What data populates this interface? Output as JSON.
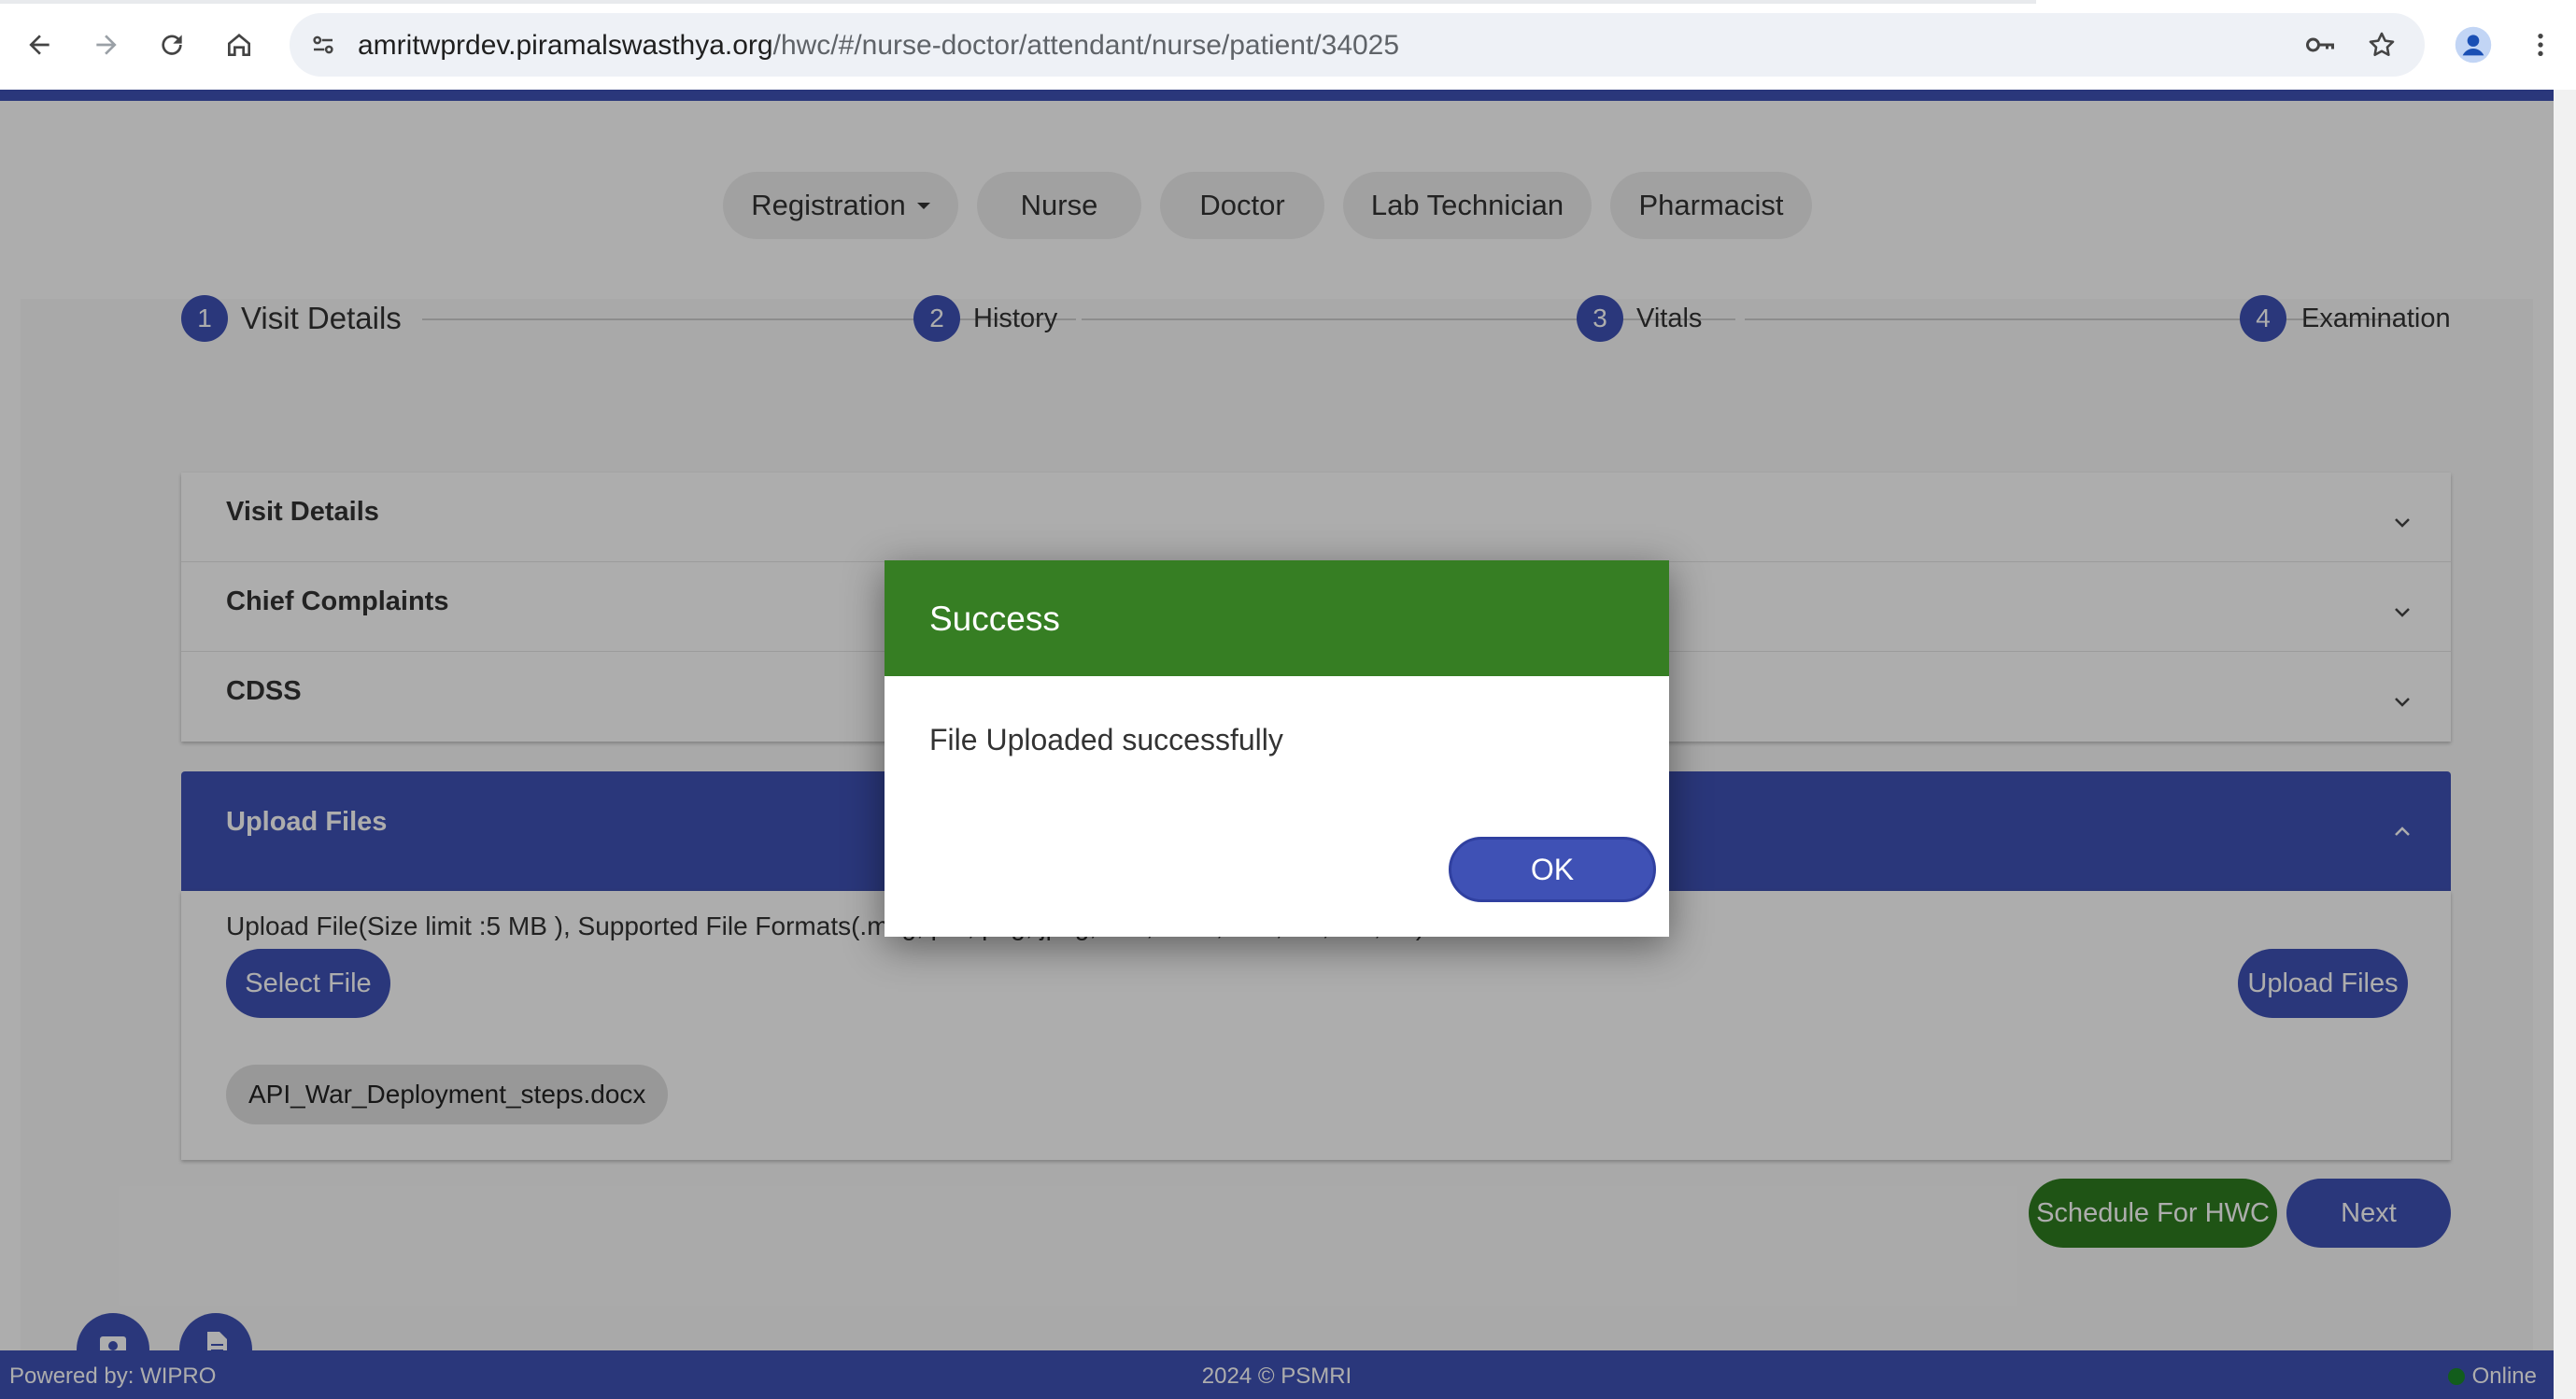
{
  "browser": {
    "url_host": "amritwprdev.piramalswasthya.org",
    "url_path": "/hwc/#/nurse-doctor/attendant/nurse/patient/34025"
  },
  "roles": [
    "Registration",
    "Nurse",
    "Doctor",
    "Lab Technician",
    "Pharmacist"
  ],
  "stepper": [
    {
      "number": "1",
      "label": "Visit Details"
    },
    {
      "number": "2",
      "label": "History"
    },
    {
      "number": "3",
      "label": "Vitals"
    },
    {
      "number": "4",
      "label": "Examination"
    }
  ],
  "accordion": [
    "Visit Details",
    "Chief Complaints",
    "CDSS"
  ],
  "upload": {
    "title": "Upload Files",
    "info": "Upload File(Size limit :5 MB ), Supported File Formats(.msg,.pdf,.png,.jpeg,.doc,.docx,.xlsx,.xls,.csv,.txt)",
    "select_label": "Select File",
    "upload_label": "Upload Files",
    "file_name": "API_War_Deployment_steps.docx"
  },
  "actions": {
    "schedule_label": "Schedule For HWC",
    "next_label": "Next"
  },
  "footer": {
    "powered": "Powered by: WIPRO",
    "copyright": "2024 © PSMRI",
    "status": "Online"
  },
  "dialog": {
    "title": "Success",
    "message": "File Uploaded successfully",
    "ok_label": "OK"
  },
  "colors": {
    "primary": "#3f51b5",
    "success": "#367e23",
    "online": "#1b8a2a"
  }
}
